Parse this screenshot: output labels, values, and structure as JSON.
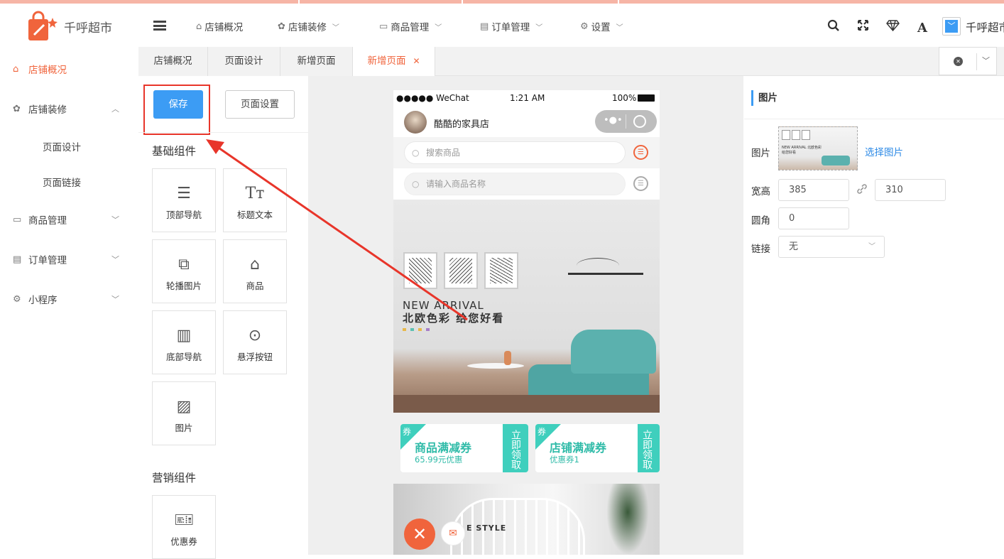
{
  "app": {
    "name": "千呼超市",
    "user_label": "千呼超市"
  },
  "colors": {
    "accent": "#3c9cf4",
    "brand": "#f0643c",
    "active_tab": "#f0643c",
    "highlight": "#e8352a",
    "teal": "#3fcfbd"
  },
  "topnav": {
    "items": [
      {
        "label": "店铺概况",
        "icon": "home-icon",
        "dropdown": false
      },
      {
        "label": "店铺装修",
        "icon": "palette-icon",
        "dropdown": true
      },
      {
        "label": "商品管理",
        "icon": "box-icon",
        "dropdown": true
      },
      {
        "label": "订单管理",
        "icon": "document-icon",
        "dropdown": true
      },
      {
        "label": "设置",
        "icon": "gear-icon",
        "dropdown": true
      }
    ],
    "right_icons": [
      "search-icon",
      "fullscreen-icon",
      "diamond-icon",
      "font-icon",
      "checkbox-icon"
    ]
  },
  "sidebar": {
    "items": [
      {
        "label": "店铺概况",
        "icon": "home-icon",
        "active": true
      },
      {
        "label": "店铺装修",
        "icon": "palette-icon",
        "expanded": true,
        "children": [
          "页面设计",
          "页面链接"
        ]
      },
      {
        "label": "商品管理",
        "icon": "box-icon"
      },
      {
        "label": "订单管理",
        "icon": "document-icon"
      },
      {
        "label": "小程序",
        "icon": "gear-icon"
      }
    ]
  },
  "tabs": [
    {
      "label": "店铺概况"
    },
    {
      "label": "页面设计"
    },
    {
      "label": "新增页面"
    },
    {
      "label": "新增页面",
      "active": true,
      "closable": true
    }
  ],
  "editor": {
    "save_label": "保存",
    "page_settings_label": "页面设置",
    "basic_title": "基础组件",
    "basic_components": [
      {
        "label": "顶部导航",
        "icon": "list-icon"
      },
      {
        "label": "标题文本",
        "icon": "text-icon"
      },
      {
        "label": "轮播图片",
        "icon": "carousel-icon"
      },
      {
        "label": "商品",
        "icon": "bag-icon"
      },
      {
        "label": "底部导航",
        "icon": "bars-icon"
      },
      {
        "label": "悬浮按钮",
        "icon": "target-icon"
      },
      {
        "label": "图片",
        "icon": "image-icon"
      }
    ],
    "marketing_title": "营销组件",
    "marketing_components": [
      {
        "label": "优惠券",
        "icon": "ticket-icon"
      }
    ]
  },
  "preview": {
    "status": {
      "carrier": "●●●●● WeChat",
      "time": "1:21 AM",
      "battery": "100%"
    },
    "shop_name": "酷酷的家具店",
    "search1_placeholder": "搜索商品",
    "search2_placeholder": "请输入商品名称",
    "banner": {
      "heading": "NEW ARRIVAL",
      "subheading": "北欧色彩 给您好看"
    },
    "coupons": [
      {
        "tag": "券",
        "title": "商品满减券",
        "sub": "65.99元优惠",
        "side": "立即领取"
      },
      {
        "tag": "券",
        "title": "店铺满减券",
        "sub": "优惠券1",
        "side": "立即领取"
      }
    ],
    "bed_caption": "E STYLE"
  },
  "properties": {
    "title": "图片",
    "image_label": "图片",
    "choose_image": "选择图片",
    "thumb_text": "NEW ARRIVAL 北欧色彩 给您好看",
    "size_label": "宽高",
    "width": "385",
    "height": "310",
    "radius_label": "圆角",
    "radius": "0",
    "link_label": "链接",
    "link_value": "无"
  }
}
